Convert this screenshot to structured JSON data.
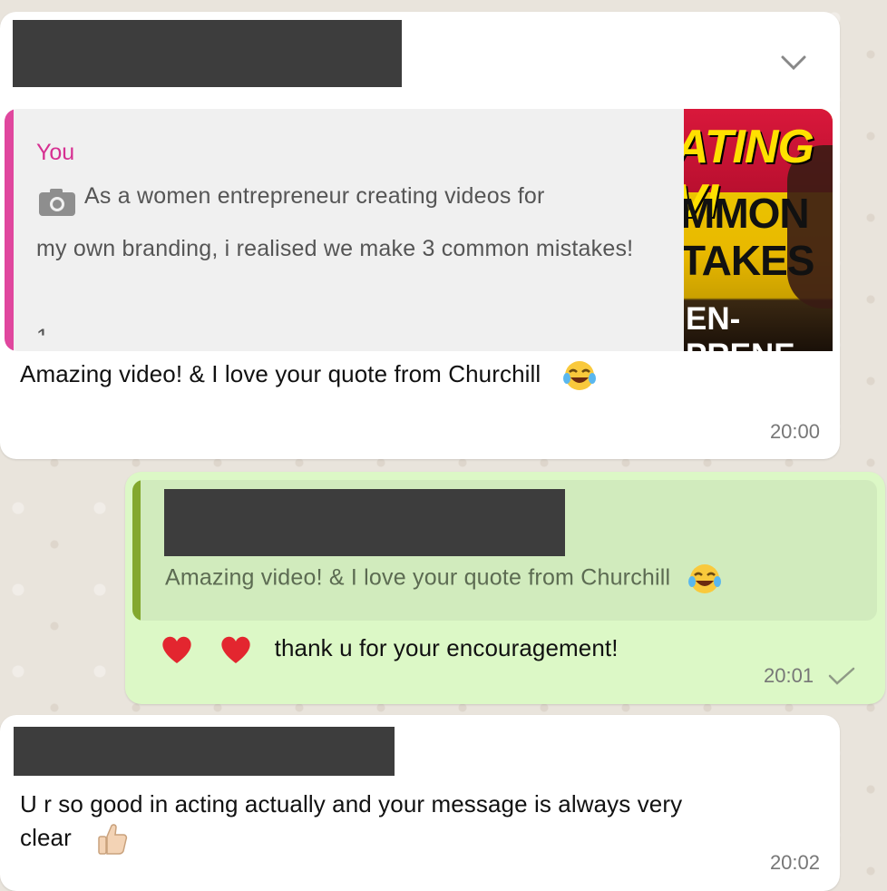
{
  "messages": [
    {
      "type": "incoming",
      "reply_to": {
        "author": "You",
        "text_line1": "As a women entrepreneur creating videos for",
        "text_rest": "my own branding, i realised we make 3 common mistakes!",
        "text_cutoff": "1. ... ...",
        "thumbnail_text": [
          "ATING VI",
          "MMON",
          "TAKES",
          "EN-PRENE"
        ]
      },
      "text": "Amazing video! & I love your quote from Churchill",
      "time": "20:00"
    },
    {
      "type": "outgoing",
      "reply_to": {
        "text": "Amazing video! & I love your quote from Churchill"
      },
      "text": "thank u for your encouragement!",
      "time": "20:01",
      "status": "sent"
    },
    {
      "type": "incoming",
      "text_line1": "U r so good in acting actually and your message is always very",
      "text_line2": "clear",
      "time": "20:02"
    }
  ],
  "icons": {
    "menu": "chevron-down-icon",
    "quote_media": "camera-icon",
    "status": "check-icon",
    "emojis": [
      "laughing-tears-emoji",
      "heart-emoji",
      "thumbs-up-emoji"
    ]
  },
  "colors": {
    "incoming_bubble": "#ffffff",
    "outgoing_bubble": "#dcf8c6",
    "quote_author": "#d62f91",
    "quote_bar_incoming": "#e0479e",
    "quote_bar_outgoing": "#83a82e"
  }
}
